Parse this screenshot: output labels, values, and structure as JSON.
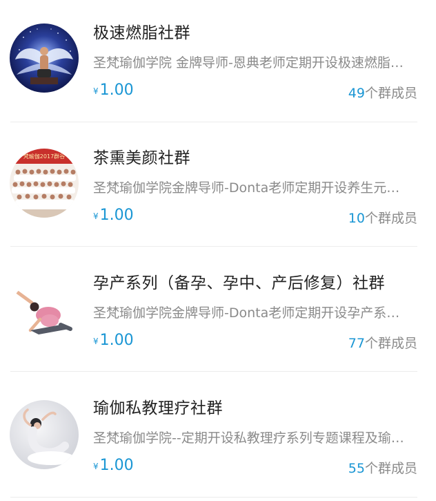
{
  "groups": [
    {
      "title": "极速燃脂社群",
      "description": "圣梵瑜伽学院 金牌导师-恩典老师定期开设极速燃脂系列专题课程及",
      "currency": "¥",
      "price": "1.00",
      "member_count": "49",
      "member_suffix": "个群成员",
      "avatar_icon": "yoga-man-stage-avatar"
    },
    {
      "title": "茶熏美颜社群",
      "description": "圣梵瑜伽学院金牌导师-Donta老师定期开设养生元素系列专题课程及",
      "currency": "¥",
      "price": "1.00",
      "member_count": "10",
      "member_suffix": "个群成员",
      "avatar_icon": "group-photo-avatar",
      "avatar_banner_text": "梵瑜伽2017群谷"
    },
    {
      "title": "孕产系列（备孕、孕中、产后修复）社群",
      "description": "圣梵瑜伽学院金牌导师-Donta老师定期开设孕产系列专题课程及",
      "currency": "¥",
      "price": "1.00",
      "member_count": "77",
      "member_suffix": "个群成员",
      "avatar_icon": "pregnant-yoga-pose-avatar"
    },
    {
      "title": "瑜伽私教理疗社群",
      "description": "圣梵瑜伽学院--定期开设私教理疗系列专题课程及瑜伽理疗分享",
      "currency": "¥",
      "price": "1.00",
      "member_count": "55",
      "member_suffix": "个群成员",
      "avatar_icon": "yoga-woman-backbend-avatar"
    }
  ],
  "colors": {
    "accent": "#1a96d4",
    "title": "#222222",
    "muted": "#8a8a8a",
    "divider": "#ececec"
  }
}
